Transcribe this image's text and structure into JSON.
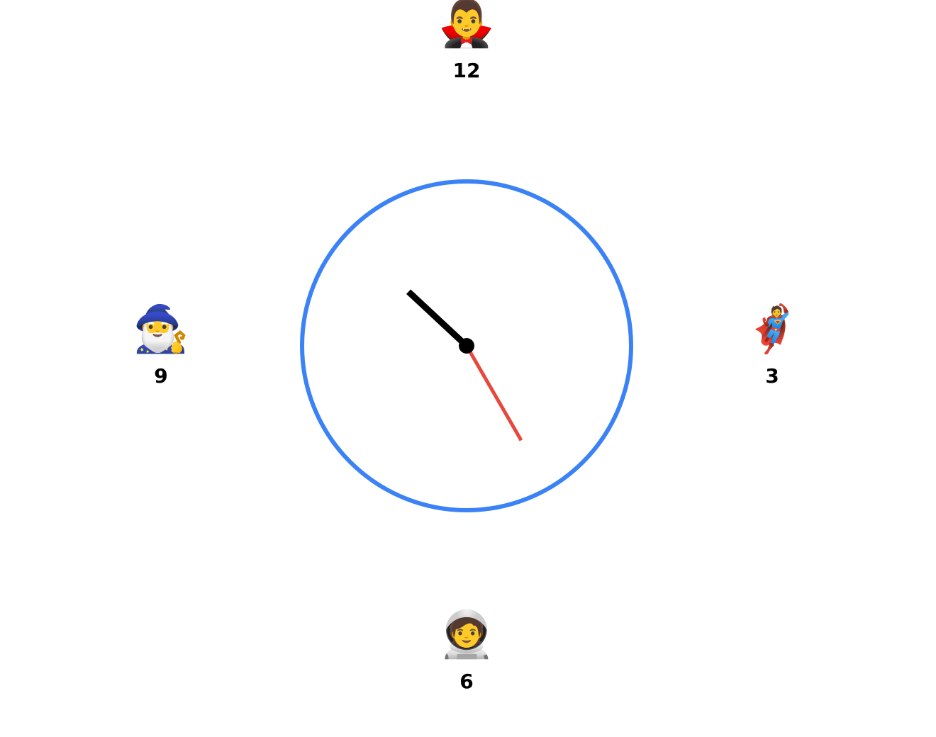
{
  "markers": {
    "twelve": {
      "label": "12",
      "emoji": "🧛‍♂️",
      "icon": "vampire-icon"
    },
    "three": {
      "label": "3",
      "emoji": "🦸",
      "icon": "superhero-icon"
    },
    "six": {
      "label": "6",
      "emoji": "🧑‍🚀",
      "icon": "astronaut-icon"
    },
    "nine": {
      "label": "9",
      "emoji": "🧙‍♂️",
      "icon": "wizard-icon"
    }
  },
  "clock": {
    "ring_color": "#3b82f6",
    "hour_hand_color": "#000000",
    "second_hand_color": "#e8473e",
    "center_color": "#000000",
    "hour_hand_degrees": 313,
    "second_hand_degrees": 150
  }
}
